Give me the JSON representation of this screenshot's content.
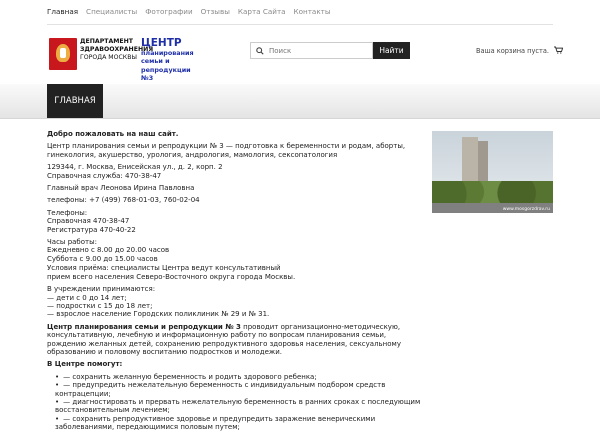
{
  "topnav": [
    "Главная",
    "Специалисты",
    "Фотографии",
    "Отзывы",
    "Карта Сайта",
    "Контакты"
  ],
  "logo": {
    "dept_line1": "ДЕПАРТАМЕНТ",
    "dept_line2": "ЗДРАВООХРАНЕНИЯ",
    "dept_line3": "ГОРОДА МОСКВЫ",
    "center_title": "ЦЕНТР",
    "center_sub1": "планирования",
    "center_sub2": "семьи и",
    "center_sub3": "репродукции №3"
  },
  "search": {
    "placeholder": "Поиск",
    "button": "Найти"
  },
  "basket": {
    "label": "Ваша корзина пуста."
  },
  "mainnav": {
    "home": "ГЛАВНАЯ"
  },
  "photo": {
    "watermark": "www.mosgorzdrav.ru"
  },
  "content": {
    "welcome": "Добро пожаловать на наш сайт.",
    "intro": "Центр планирования семьи и репродукции № 3 — подготовка к беременности и родам, аборты, гинекология, акушерство, урология, андрология, мамология, сексопатология",
    "address": "129344, г. Москва, Енисейская ул., д. 2, корп. 2",
    "help_service": "Справочная служба: 470-38-47",
    "chief": "Главный врач Леонова Ирина Павловна",
    "phones": "телефоны: +7 (499) 768-01-03, 760-02-04",
    "phones_title": "Телефоны:",
    "phone_help": "Справочная 470-38-47",
    "phone_reg": "Регистратура 470-40-22",
    "hours_title": "Часы работы:",
    "hours_weekdays": "Ежедневно с 8.00 до 20.00 часов",
    "hours_saturday": "Суббота с 9.00 до 15.00 часов",
    "conditions1": "Условия приёма: специалисты Центра ведут консультативный",
    "conditions2": "прием всего населения Северо-Восточного округа города Москвы.",
    "accepts_title": "В учреждении принимаются:",
    "accepts1": "— дети с 0 до 14 лет;",
    "accepts2": "— подростки с 15 до 18 лет;",
    "accepts3": "— взрослое население Городских поликлиник № 29 и № 31.",
    "mission_bold": "Центр планирования семьи и репродукции № 3",
    "mission_rest": " проводит организационно-методическую, консультативную, лечебную и информационную работу по вопросам планирования семьи, рождению желанных детей, сохранению репродуктивного здоровья населения, сексуальному образованию и половому воспитанию подростков и молодежи.",
    "helps_title": "В Центре помогут:",
    "helps": [
      "— сохранить желанную беременность и родить здорового ребенка;",
      "— предупредить нежелательную беременность с индивидуальным подбором средств контрацепции;",
      "— диагностировать и прервать нежелательную беременность в ранних сроках с последующим восстановительным лечением;",
      "— сохранить репродуктивное здоровье и предупредить заражение венерическими заболеваниями, передающимися половым путем;"
    ]
  }
}
